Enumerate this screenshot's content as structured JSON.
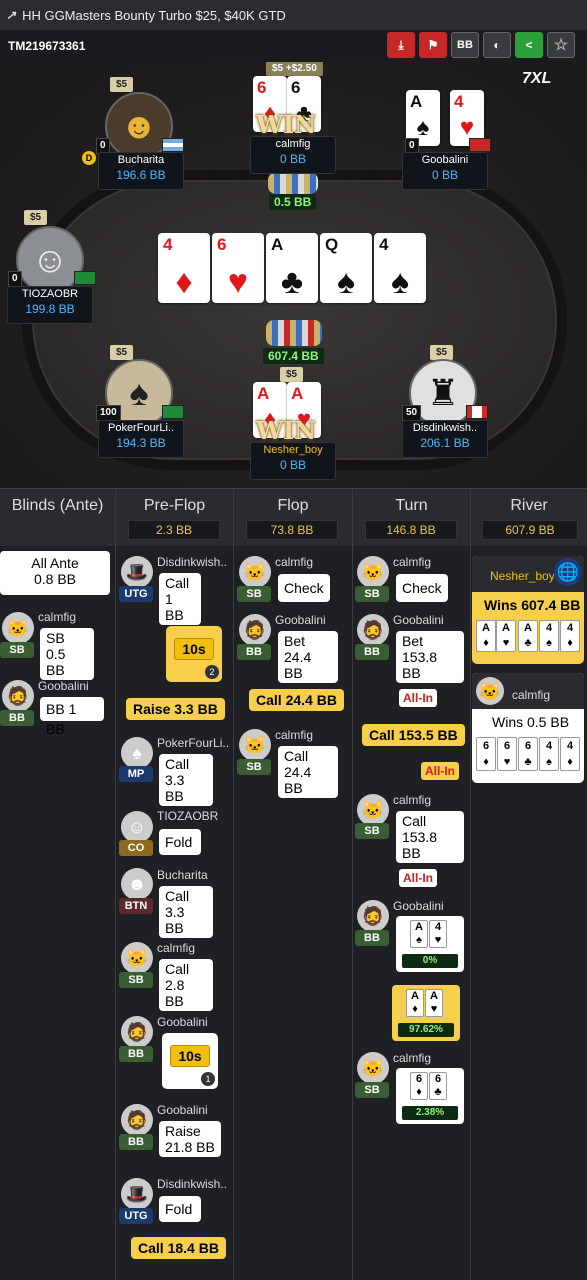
{
  "title": {
    "text": "HH  GGMasters Bounty Turbo $25, $40K GTD",
    "logo": "↗"
  },
  "hand_id": "TM219673361",
  "toolbar": {
    "download": "⤓",
    "flag": "⚑",
    "bb": "BB",
    "incognito": "◐",
    "share": "<",
    "star": "☆"
  },
  "table": {
    "brand": "7XL",
    "board": [
      {
        "rank": "4",
        "suit": "♦",
        "color": "red"
      },
      {
        "rank": "6",
        "suit": "♥",
        "color": "red"
      },
      {
        "rank": "A",
        "suit": "♣",
        "color": "blk"
      },
      {
        "rank": "Q",
        "suit": "♠",
        "color": "blk"
      },
      {
        "rank": "4",
        "suit": "♠",
        "color": "blk"
      }
    ],
    "pot_top": "0.5 BB",
    "pot_main": "607.4 BB",
    "players": {
      "bucharita": {
        "name": "Bucharita",
        "stack": "196.6 BB",
        "bet": "$5",
        "chips": "0",
        "dealer": "D"
      },
      "calmfig": {
        "name": "calmfig",
        "stack": "0 BB",
        "bet": "$5 +$2.50",
        "win": "WIN",
        "c1": "6",
        "c2": "6"
      },
      "goobalini": {
        "name": "Goobalini",
        "stack": "0 BB",
        "chips": "0",
        "c1": "A",
        "c2": "4"
      },
      "tiozaobr": {
        "name": "TIOZAOBR",
        "stack": "199.8 BB",
        "bet": "$5",
        "chips": "0"
      },
      "pokerfour": {
        "name": "PokerFourLi..",
        "stack": "194.3 BB",
        "bet": "$5",
        "chips": "100"
      },
      "nesher": {
        "name": "Nesher_boy",
        "stack": "0 BB",
        "bet": "$5",
        "win": "WIN",
        "c1": "A",
        "c2": "A"
      },
      "disdink": {
        "name": "Disdinkwish..",
        "stack": "206.1 BB",
        "bet": "$5",
        "chips": "50"
      }
    }
  },
  "history": {
    "columns": [
      {
        "label": "Blinds (Ante)",
        "pot": ""
      },
      {
        "label": "Pre-Flop",
        "pot": "2.3 BB"
      },
      {
        "label": "Flop",
        "pot": "73.8 BB"
      },
      {
        "label": "Turn",
        "pot": "146.8 BB"
      },
      {
        "label": "River",
        "pot": "607.9 BB"
      }
    ],
    "blinds": {
      "ante_title": "All Ante",
      "ante_val": "0.8 BB",
      "sb_name": "calmfig",
      "sb_pos": "SB",
      "sb_text1": "SB",
      "sb_text2": "0.5 BB",
      "bb_name": "Goobalini",
      "bb_pos": "BB",
      "bb_text": "BB 1 BB"
    },
    "preflop": {
      "p1_name": "Disdinkwish..",
      "p1_pos": "UTG",
      "p1_a": "Call",
      "p1_b": "1 BB",
      "timer1": "10s",
      "timer1_n": "2",
      "raise1": "Raise 3.3 BB",
      "p2_name": "PokerFourLi..",
      "p2_pos": "MP",
      "p2_a": "Call",
      "p2_b": "3.3 BB",
      "p3_name": "TIOZAOBR",
      "p3_pos": "CO",
      "p3_a": "Fold",
      "p4_name": "Bucharita",
      "p4_pos": "BTN",
      "p4_a": "Call",
      "p4_b": "3.3 BB",
      "p5_name": "calmfig",
      "p5_pos": "SB",
      "p5_a": "Call",
      "p5_b": "2.8 BB",
      "p6_name": "Goobalini",
      "p6_pos": "BB",
      "timer2": "10s",
      "timer2_n": "1",
      "p7_name": "Goobalini",
      "p7_pos": "BB",
      "p7_a": "Raise",
      "p7_b": "21.8 BB",
      "p8_name": "Disdinkwish..",
      "p8_pos": "UTG",
      "p8_a": "Fold",
      "call1": "Call 18.4 BB"
    },
    "flop": {
      "p1_name": "calmfig",
      "p1_pos": "SB",
      "p1_a": "Check",
      "p2_name": "Goobalini",
      "p2_pos": "BB",
      "p2_a": "Bet",
      "p2_b": "24.4 BB",
      "call1": "Call 24.4 BB",
      "p3_name": "calmfig",
      "p3_pos": "SB",
      "p3_a": "Call",
      "p3_b": "24.4 BB"
    },
    "turn": {
      "p1_name": "calmfig",
      "p1_pos": "SB",
      "p1_a": "Check",
      "p2_name": "Goobalini",
      "p2_pos": "BB",
      "p2_a": "Bet",
      "p2_b": "153.8 BB",
      "allin1": "All-In",
      "call1": "Call 153.5 BB",
      "allin2": "All-In",
      "p3_name": "calmfig",
      "p3_pos": "SB",
      "p3_a": "Call",
      "p3_b": "153.8 BB",
      "allin3": "All-In",
      "p4_name": "Goobalini",
      "p4_pos": "BB",
      "eq1": "0%",
      "eq2": "97.62%",
      "p5_name": "calmfig",
      "p5_pos": "SB",
      "eq3": "2.38%"
    },
    "river": {
      "w1_name": "Nesher_boy",
      "w1_text": "Wins 607.4 BB",
      "w2_name": "calmfig",
      "w2_text": "Wins 0.5 BB"
    }
  }
}
